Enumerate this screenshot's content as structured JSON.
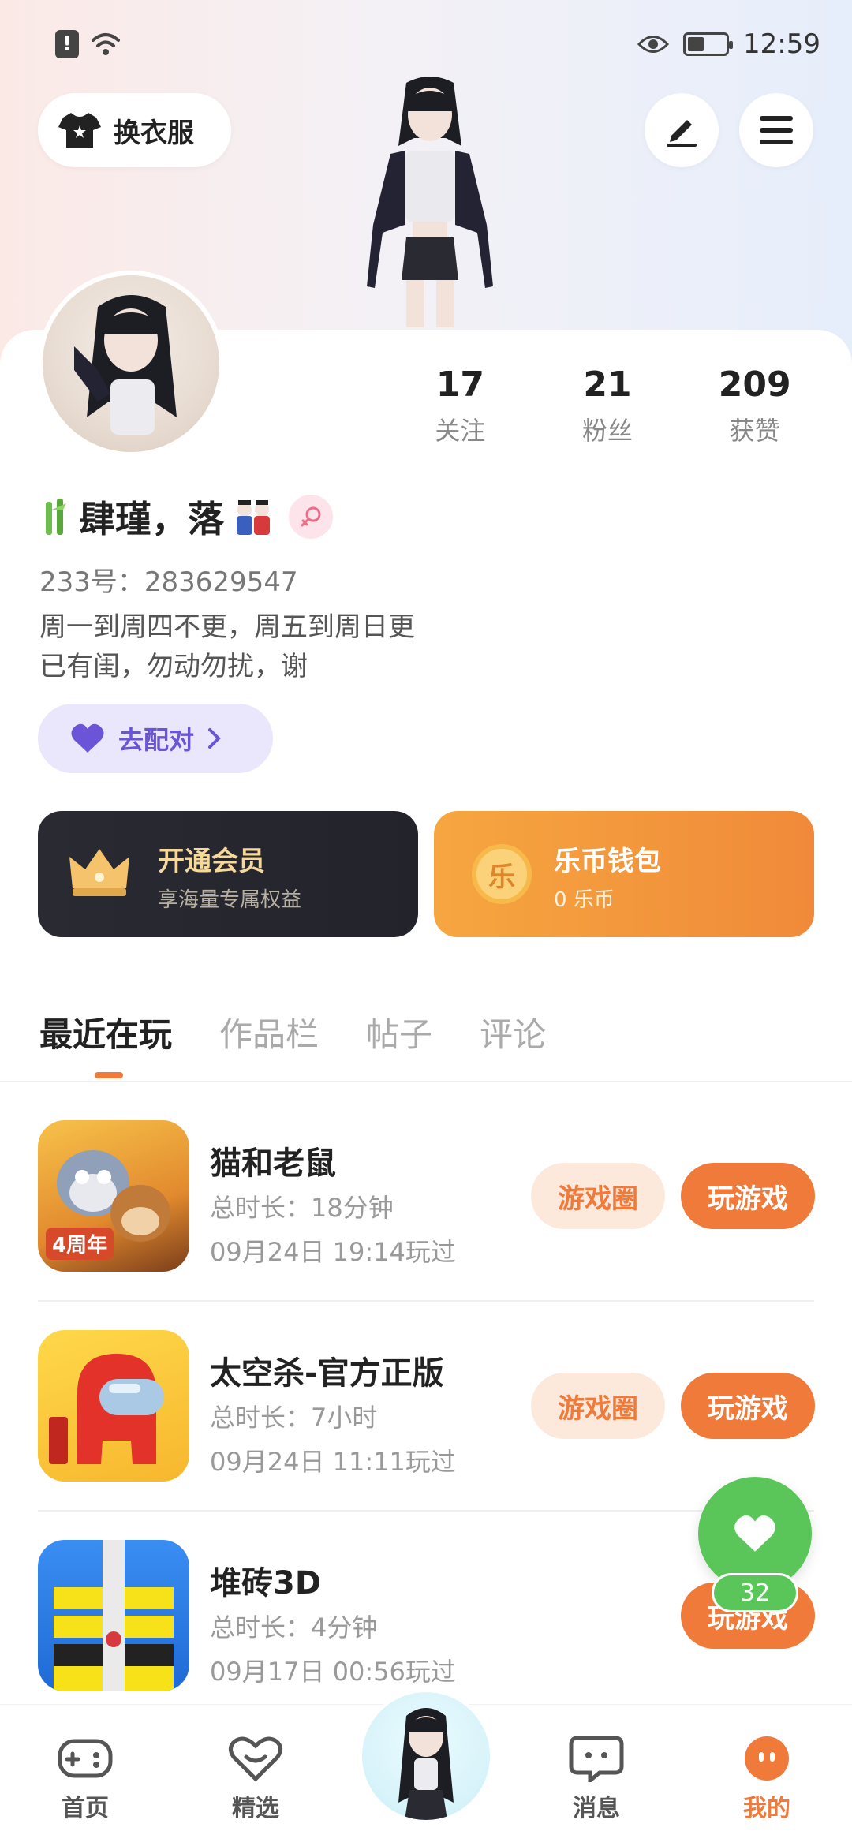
{
  "status_bar": {
    "time": "12:59"
  },
  "header": {
    "outfit_label": "换衣服"
  },
  "profile": {
    "stats": [
      {
        "value": "17",
        "label": "关注"
      },
      {
        "value": "21",
        "label": "粉丝"
      },
      {
        "value": "209",
        "label": "获赞"
      }
    ],
    "username": "肆瑾，落",
    "user_id": "233号：283629547",
    "bio_line1": "周一到周四不更，周五到周日更",
    "bio_line2": "已有闺，勿动勿扰，谢",
    "match_label": "去配对"
  },
  "cards": {
    "vip_title": "开通会员",
    "vip_sub": "享海量专属权益",
    "wallet_title": "乐币钱包",
    "wallet_sub": "0 乐币",
    "wallet_icon_char": "乐"
  },
  "tabs": [
    {
      "label": "最近在玩",
      "active": true
    },
    {
      "label": "作品栏",
      "active": false
    },
    {
      "label": "帖子",
      "active": false
    },
    {
      "label": "评论",
      "active": false
    }
  ],
  "games": [
    {
      "name": "猫和老鼠",
      "duration": "总时长：18分钟",
      "last_played": "09月24日 19:14玩过",
      "icon_badge": "4周年",
      "circle_label": "游戏圈",
      "play_label": "玩游戏"
    },
    {
      "name": "太空杀-官方正版",
      "duration": "总时长：7小时",
      "last_played": "09月24日 11:11玩过",
      "circle_label": "游戏圈",
      "play_label": "玩游戏"
    },
    {
      "name": "堆砖3D",
      "duration": "总时长：4分钟",
      "last_played": "09月17日 00:56玩过",
      "play_label": "玩游戏"
    }
  ],
  "like_count": "32",
  "bottom_nav": [
    {
      "label": "首页"
    },
    {
      "label": "精选"
    },
    {
      "label": "消息"
    },
    {
      "label": "我的"
    }
  ],
  "colors": {
    "accent": "#f07a3a",
    "like_green": "#5ac65a",
    "match_purple": "#6b55d6"
  }
}
